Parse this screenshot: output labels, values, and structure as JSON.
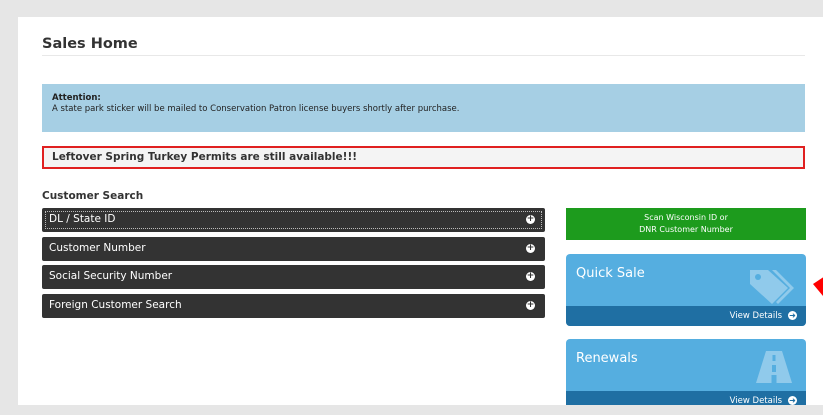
{
  "page": {
    "title": "Sales Home"
  },
  "attention": {
    "heading": "Attention:",
    "message": "A state park sticker will be mailed to Conservation Patron license buyers shortly after purchase."
  },
  "leftover_notice": "Leftover Spring Turkey Permits are still available!!!",
  "customer_search": {
    "heading": "Customer Search",
    "items": [
      {
        "label": "DL / State ID"
      },
      {
        "label": "Customer Number"
      },
      {
        "label": "Social Security Number"
      },
      {
        "label": "Foreign Customer Search"
      }
    ]
  },
  "scan": {
    "line1": "Scan Wisconsin ID or",
    "line2": "DNR Customer Number"
  },
  "tiles": [
    {
      "label": "Quick Sale",
      "footer": "View Details",
      "icon": "tag-icon"
    },
    {
      "label": "Renewals",
      "footer": "View Details",
      "icon": "road-icon"
    }
  ],
  "colors": {
    "attention_bg": "#a6cfe4",
    "notice_border": "#e02020",
    "accordion_bg": "#333333",
    "scan_bg": "#1d9b1d",
    "tile_bg": "#55aee0",
    "tile_footer_bg": "#1f6fa3",
    "annotation_arrow": "#ff0000"
  }
}
